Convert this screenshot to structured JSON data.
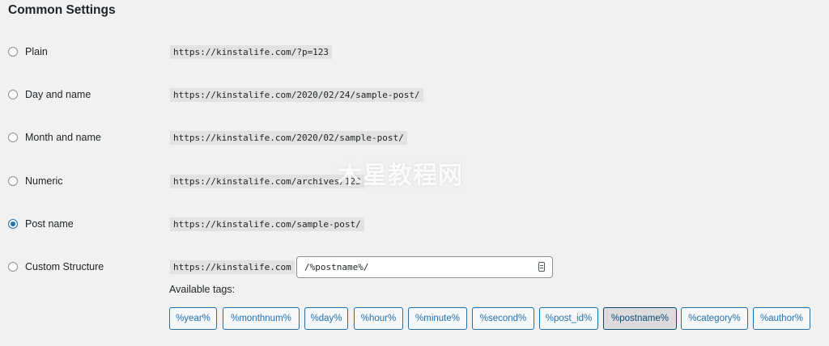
{
  "section": {
    "heading": "Common Settings"
  },
  "options": [
    {
      "label": "Plain",
      "url": "https://kinstalife.com/?p=123",
      "checked": false
    },
    {
      "label": "Day and name",
      "url": "https://kinstalife.com/2020/02/24/sample-post/",
      "checked": false
    },
    {
      "label": "Month and name",
      "url": "https://kinstalife.com/2020/02/sample-post/",
      "checked": false
    },
    {
      "label": "Numeric",
      "url": "https://kinstalife.com/archives/123",
      "checked": false
    },
    {
      "label": "Post name",
      "url": "https://kinstalife.com/sample-post/",
      "checked": true
    },
    {
      "label": "Custom Structure",
      "url": "https://kinstalife.com",
      "checked": false
    }
  ],
  "custom_structure": {
    "value": "/%postname%/"
  },
  "tags": {
    "label": "Available tags:",
    "items": [
      "%year%",
      "%monthnum%",
      "%day%",
      "%hour%",
      "%minute%",
      "%second%",
      "%post_id%",
      "%postname%",
      "%category%",
      "%author%"
    ],
    "active": "%postname%"
  },
  "watermark": "木星教程网",
  "colors": {
    "accent": "#2271b1",
    "background": "#f1f1f1",
    "code_bg": "#e2e2e2"
  }
}
